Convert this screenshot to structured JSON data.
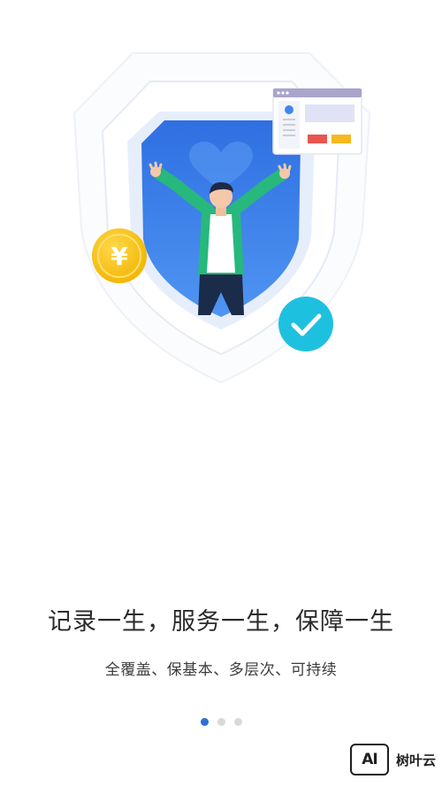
{
  "onboarding": {
    "headline": "记录一生，服务一生，保障一生",
    "subline": "全覆盖、保基本、多层次、可持续",
    "pager": {
      "total": 3,
      "active_index": 0
    },
    "coin_symbol": "¥",
    "colors": {
      "shield_blue": "#3f86ee",
      "coin_gold": "#f6c20c",
      "check_teal": "#1ec0e0",
      "dot_active": "#2f6fd6",
      "dot_inactive": "#d9d9d9"
    }
  },
  "watermark": {
    "logo_text": "AI",
    "brand_text": "树叶云"
  }
}
